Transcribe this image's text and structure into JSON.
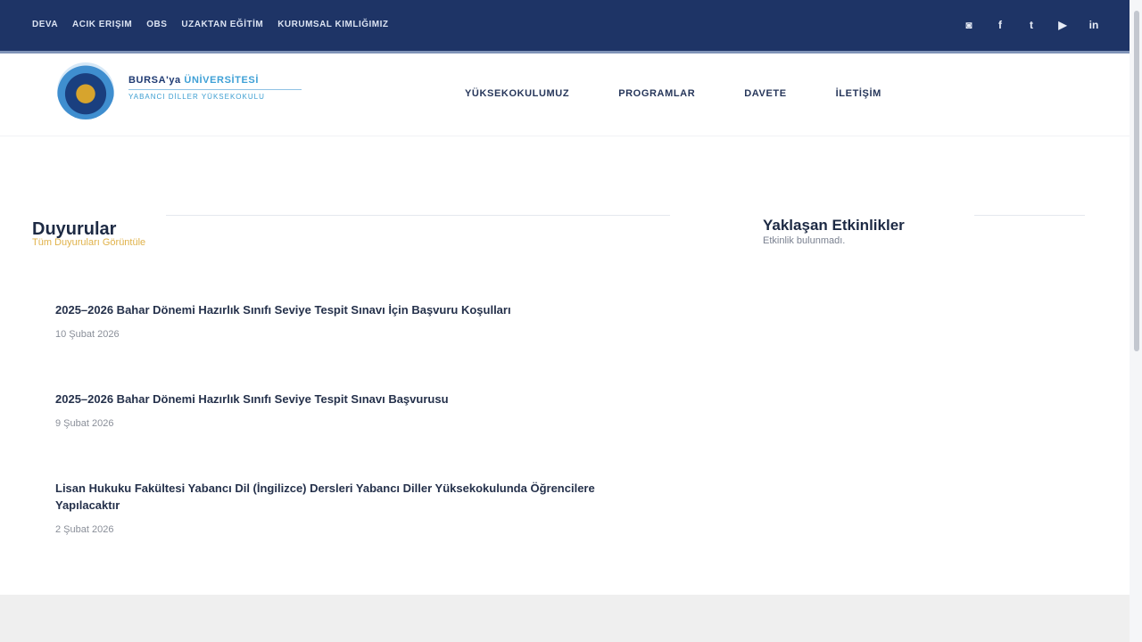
{
  "topbar": {
    "nav": [
      "DEVA",
      "ACIK ERIŞIM",
      "OBS",
      "UZAKTAN EĞİTİM",
      "KURUMSAL KIMLIĞIMIZ"
    ],
    "social_icons": [
      "instagram-icon",
      "facebook-icon",
      "twitter-icon",
      "youtube-icon",
      "linkedin-icon"
    ]
  },
  "brand": {
    "title_primary": "BURSA'ya",
    "title_accent": "ÜNİVERSİTESİ",
    "subtitle": "YABANCI DİLLER YÜKSEKOKULU"
  },
  "mainnav": [
    "YÜKSEKOKULUMUZ",
    "PROGRAMLAR",
    "DAVETE",
    "İLETİŞİM"
  ],
  "announcements": {
    "title": "Duyurular",
    "all_label": "Tüm Duyuruları Görüntüle",
    "items": [
      {
        "title": "2025–2026 Bahar Dönemi Hazırlık Sınıfı Seviye Tespit Sınavı İçin Başvuru Koşulları",
        "date": "10 Şubat 2026"
      },
      {
        "title": "2025–2026 Bahar Dönemi Hazırlık Sınıfı Seviye Tespit Sınavı Başvurusu",
        "date": "9 Şubat 2026"
      },
      {
        "title": "Lisan Hukuku Fakültesi Yabancı Dil (İngilizce) Dersleri Yabancı Diller Yüksekokulunda Öğrencilere Yapılacaktır",
        "date": "2 Şubat 2026"
      }
    ]
  },
  "upcoming": {
    "title": "Yaklaşan Etkinlikler",
    "empty_text": "Etkinlik bulunmadı."
  }
}
